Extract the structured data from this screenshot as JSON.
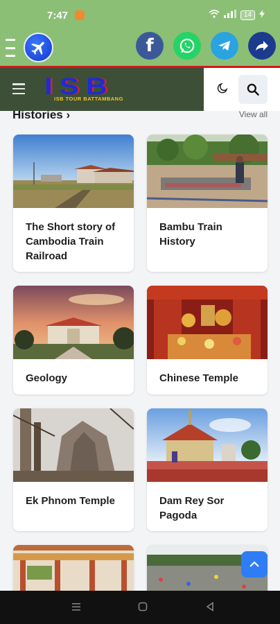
{
  "status": {
    "time": "7:47",
    "battery": "14"
  },
  "header": {
    "logo_text": "ISB",
    "logo_subtitle": "ISB TOUR BATTAMBANG"
  },
  "section": {
    "title": "Histories ›",
    "view_all": "View all"
  },
  "cards": [
    {
      "title": "The Short story of Cambodia Train Railroad"
    },
    {
      "title": "Bambu Train History"
    },
    {
      "title": "Geology"
    },
    {
      "title": "Chinese Temple"
    },
    {
      "title": "Ek Phnom Temple"
    },
    {
      "title": "Dam Rey Sor Pagoda"
    },
    {
      "title": ""
    },
    {
      "title": ""
    }
  ],
  "colors": {
    "header_green": "#8bbf75",
    "nav_dark": "#3d4f36",
    "accent_blue": "#2f7df5"
  }
}
